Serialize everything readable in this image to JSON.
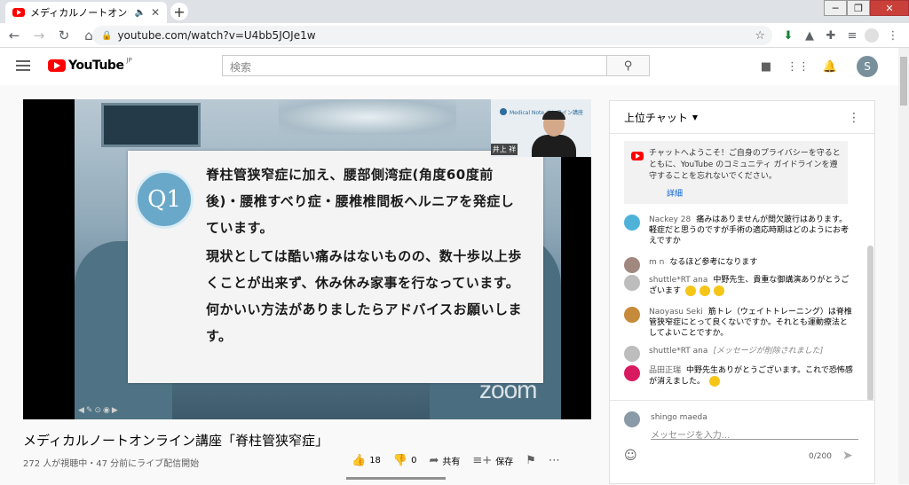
{
  "browser": {
    "tab_title": "メディカルノートオンライン",
    "tab_audio": "🔈",
    "tab_close": "✕",
    "new_tab": "+",
    "url": "youtube.com/watch?v=U4bb5JOJe1w",
    "window_controls": [
      "─",
      "❐",
      "✕"
    ]
  },
  "youtube": {
    "logo_text": "YouTube",
    "logo_region": "JP",
    "search_placeholder": "検索",
    "avatar_letter": "S"
  },
  "video": {
    "slide_badge": "Q1",
    "slide_paragraph_1": "脊柱管狭窄症に加え、腰部側湾症(角度60度前後)・腰椎すべり症・腰椎椎間板ヘルニアを発症しています。",
    "slide_paragraph_2": "現状としては酷い痛みはないものの、数十歩以上歩くことが出来ず、休み休み家事を行なっています。何かいい方法がありましたらアドバイスお願いします。",
    "pip_banner": "Medical Note オンライン講座",
    "pip_name": "井上 祥",
    "watermark": "zoom",
    "title": "メディカルノートオンライン講座「脊柱管狭窄症」",
    "meta": "272 人が視聴中・47 分前にライブ配信開始",
    "like_count": "18",
    "dislike_count": "0",
    "share_label": "共有",
    "save_label": "保存"
  },
  "chat": {
    "header": "上位チャット",
    "notice": "チャットへようこそ！ご自身のプライバシーを守るとともに、YouTube のコミュニティ ガイドラインを遵守することを忘れないでください。",
    "notice_link": "詳細",
    "messages": [
      {
        "author": "Nackey 28",
        "text": "痛みはありませんが間欠跛行はあります。軽症だと思うのですが手術の適応時期はどのようにお考えですか",
        "avatar_color": "#4fb3d9"
      },
      {
        "author": "m n",
        "text": "なるほど参考になります",
        "avatar_color": "#a1887f"
      },
      {
        "author": "shuttle*RT ana",
        "text": "中野先生、貴重な御講演ありがとうございます",
        "avatar_color": "#bdbdbd"
      },
      {
        "author": "Naoyasu Seki",
        "text": "筋トレ（ウェイトトレーニング）は脊椎管狭窄症にとって良くないですか。それとも運動療法としてよいことですか。",
        "avatar_color": "#c58b3a"
      },
      {
        "author": "shuttle*RT ana",
        "text": "[メッセージが削除されました]",
        "avatar_color": "#bdbdbd"
      },
      {
        "author": "品田正瑞",
        "text": "中野先生ありがとうございます。これで恐怖感が消えました。",
        "avatar_color": "#d81b60"
      }
    ],
    "input_user": "shingo maeda",
    "input_placeholder": "メッセージを入力...",
    "char_count": "0/200"
  }
}
